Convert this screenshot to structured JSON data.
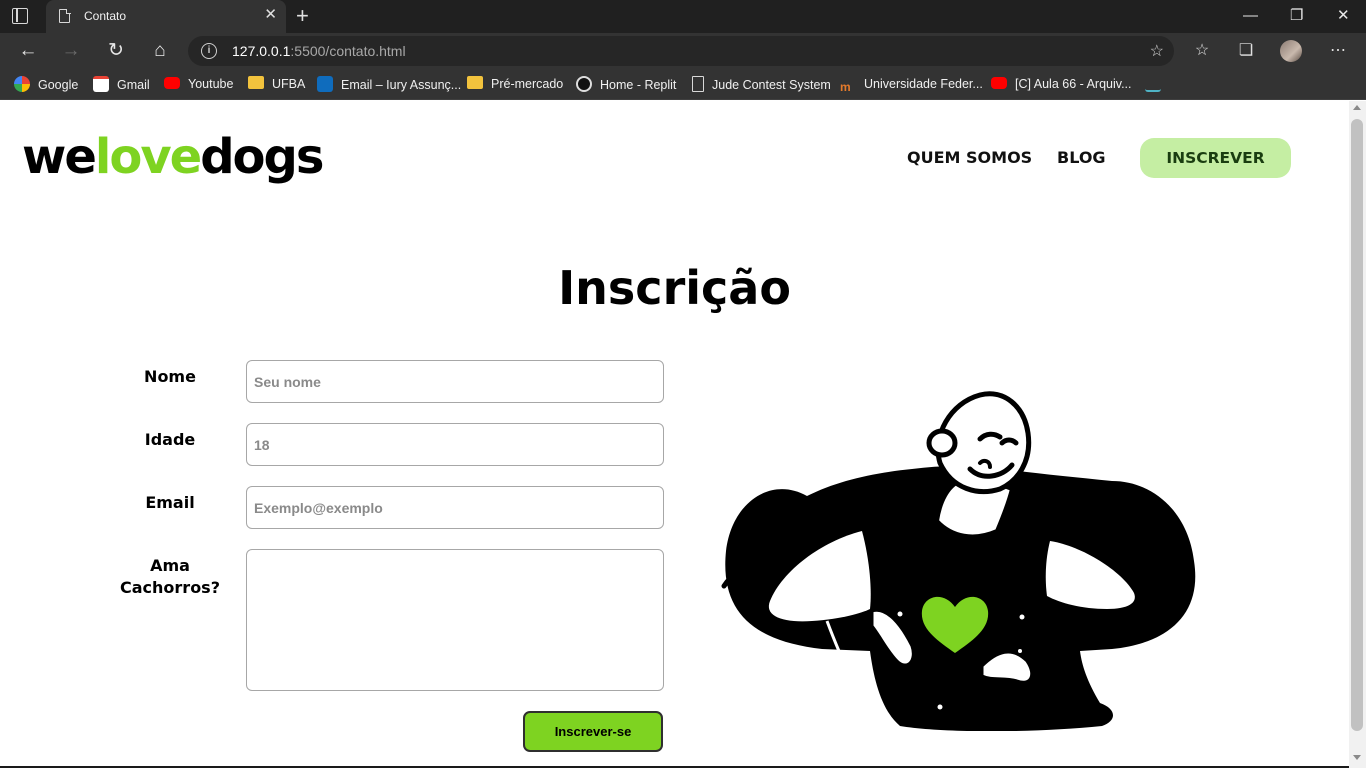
{
  "browser": {
    "tab_title": "Contato",
    "url_host": "127.0.0.1",
    "url_path": ":5500/contato.html",
    "bookmarks": [
      {
        "label": "Google",
        "icon": "google-icon"
      },
      {
        "label": "Gmail",
        "icon": "gmail-icon"
      },
      {
        "label": "Youtube",
        "icon": "youtube-icon"
      },
      {
        "label": "UFBA",
        "icon": "folder-icon"
      },
      {
        "label": "Email – Iury Assunç...",
        "icon": "outlook-icon"
      },
      {
        "label": "Pré-mercado",
        "icon": "folder-icon"
      },
      {
        "label": "Home - Replit",
        "icon": "replit-icon"
      },
      {
        "label": "Jude Contest System",
        "icon": "document-icon"
      },
      {
        "label": "Universidade Feder...",
        "icon": "university-icon"
      },
      {
        "label": "[C] Aula 66 - Arquiv...",
        "icon": "youtube-icon"
      }
    ]
  },
  "header": {
    "logo_part1": "we",
    "logo_part2": "love",
    "logo_part3": "dogs",
    "nav": {
      "about": "QUEM SOMOS",
      "blog": "BLOG",
      "cta": "INSCREVER"
    }
  },
  "main": {
    "title": "Inscrição",
    "form": {
      "name_label": "Nome",
      "name_placeholder": "Seu nome",
      "age_label": "Idade",
      "age_placeholder": "18",
      "email_label": "Email",
      "email_placeholder": "Exemplo@exemplo",
      "dogs_label_line1": "Ama",
      "dogs_label_line2": "Cachorros?",
      "submit_label": "Inscrever-se"
    }
  },
  "colors": {
    "brand_green": "#7ed321",
    "cta_background": "#c5eea3"
  }
}
